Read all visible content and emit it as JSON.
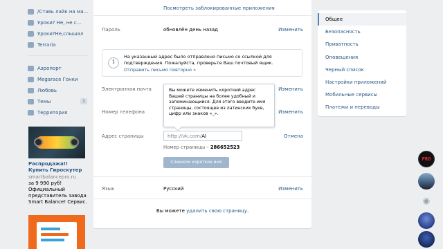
{
  "left_menu": {
    "items": [
      {
        "label": "/Ставь лайк на ма..."
      },
      {
        "label": "Уроки? Не, не с..."
      },
      {
        "label": "Уроки?Не,слышал"
      },
      {
        "label": "Terraria"
      }
    ],
    "items2": [
      {
        "label": "Аэропорт"
      },
      {
        "label": "Megarace Гонки"
      },
      {
        "label": "Любовь"
      },
      {
        "label": "Темы",
        "badge": "1"
      },
      {
        "label": "Территория"
      }
    ]
  },
  "ad": {
    "title": "Распродажа!! Купить Гироскутер",
    "domain": "smartbalancepro.ru",
    "text": "за 9 990 руб! Официальный представитель завода Smart Balance! Сервис."
  },
  "settings": {
    "blocked_apps_link": "Посмотреть заблокированные приложения",
    "password": {
      "label": "Пароль",
      "value": "обновлён день назад",
      "action": "Изменить"
    },
    "notice": {
      "text": "На указанный адрес было отправлено письмо со ссылкой для подтверждения. Пожалуйста, проверьте Ваш почтовый ящик.",
      "resend": "Отправить письмо повторно »"
    },
    "email": {
      "label": "Электронная почта",
      "action": "Изменить"
    },
    "phone": {
      "label": "Номер телефона",
      "action": "Изменить"
    },
    "tooltip": "Вы можете изменить короткий адрес Вашей страницы на более удобный и запоминающийся. Для этого введите имя страницы, состоящее из латинских букв, цифр или знаков «_».",
    "address": {
      "label": "Адрес страницы",
      "prefix": "http://vk.com/",
      "value": "Al",
      "cancel": "Отмена",
      "number_label": "Номер страницы –",
      "number": "286652523",
      "button": "Слишком короткое имя"
    },
    "language": {
      "label": "Язык",
      "value": "Русский",
      "action": "Изменить"
    },
    "delete": {
      "prefix": "Вы можете ",
      "link": "удалить свою страницу",
      "suffix": "."
    }
  },
  "right_menu": {
    "items": [
      {
        "label": "Общее",
        "active": true
      },
      {
        "label": "Безопасность"
      },
      {
        "label": "Приватность"
      },
      {
        "label": "Оповещения"
      },
      {
        "label": "Черный список"
      },
      {
        "label": "Настройки приложений"
      },
      {
        "label": "Мобильные сервисы"
      },
      {
        "label": "Платежи и переводы"
      }
    ]
  },
  "chat_bubbles": {
    "first_text": "PRO",
    "camera_icon": "camera-icon"
  },
  "colors": {
    "link": "#2a5885",
    "header": "#4a76a8",
    "button_disabled": "#9fb6cd",
    "background": "#edeef0"
  }
}
